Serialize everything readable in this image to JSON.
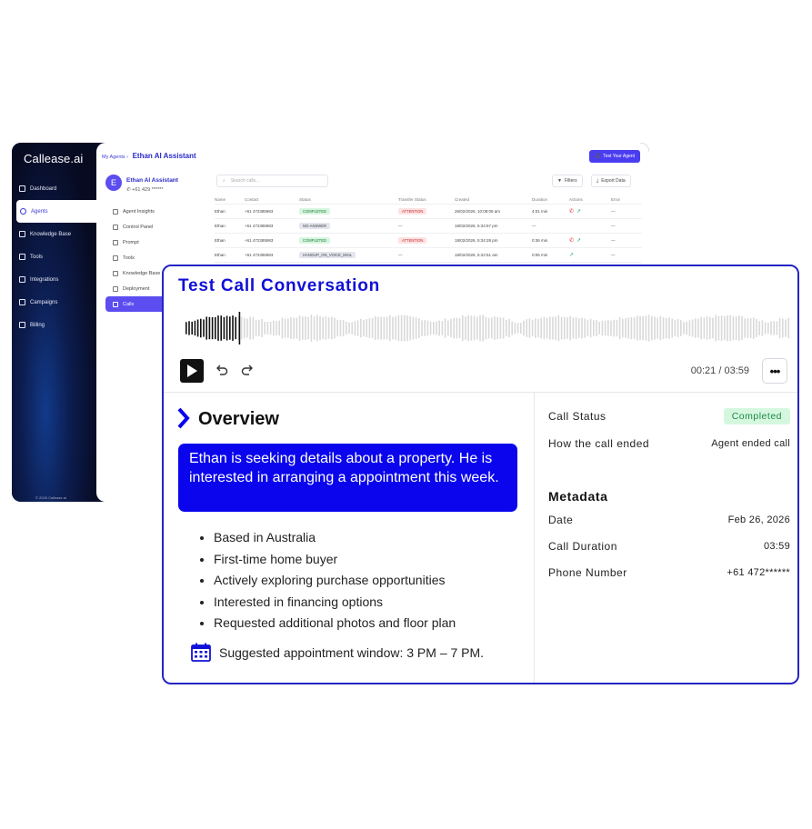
{
  "app": {
    "logo": "Callease.ai",
    "copyright": "© 2026 Callease.ai",
    "nav": [
      {
        "label": "Dashboard",
        "icon": "grid-icon"
      },
      {
        "label": "Agents",
        "icon": "agent-icon",
        "active": true
      },
      {
        "label": "Knowledge Base",
        "icon": "folder-icon"
      },
      {
        "label": "Tools",
        "icon": "bolt-icon"
      },
      {
        "label": "Integrations",
        "icon": "link-icon"
      },
      {
        "label": "Campaigns",
        "icon": "campaign-icon"
      },
      {
        "label": "Billing",
        "icon": "billing-icon"
      }
    ],
    "breadcrumb": {
      "root": "My Agents",
      "current": "Ethan AI Assistant"
    },
    "test_button": "Test Your Agent",
    "agent": {
      "initial": "E",
      "name": "Ethan AI Assistant",
      "phone": "+61 429 ******"
    },
    "sub_nav": [
      {
        "label": "Agent Insights"
      },
      {
        "label": "Control Panel"
      },
      {
        "label": "Prompt"
      },
      {
        "label": "Tools"
      },
      {
        "label": "Knowledge Base"
      },
      {
        "label": "Deployment"
      },
      {
        "label": "Calls",
        "active": true
      }
    ],
    "search_placeholder": "Search calls...",
    "filters_label": "Filters",
    "export_label": "Export Data",
    "table": {
      "headers": [
        "Name",
        "Contact",
        "Status",
        "Transfer Status",
        "Created",
        "Duration",
        "Actions",
        "Error"
      ],
      "rows": [
        {
          "name": "Ethan",
          "contact": "+61 472385983",
          "status": "COMPLETED",
          "status_kind": "green",
          "transfer": "ATTENTION",
          "created": "26/02/2026, 10:08:09 am",
          "duration": "4:01 min",
          "error": "—"
        },
        {
          "name": "Ethan",
          "contact": "+61 472385983",
          "status": "NO-ANSWER",
          "status_kind": "gray",
          "transfer": "—",
          "created": "18/02/2026, 5:34:57 pm",
          "duration": "—",
          "error": "—"
        },
        {
          "name": "Ethan",
          "contact": "+61 472385983",
          "status": "COMPLETED",
          "status_kind": "green",
          "transfer": "ATTENTION",
          "created": "18/02/2026, 5:34:28 pm",
          "duration": "0:36 min",
          "error": "—"
        },
        {
          "name": "Ethan",
          "contact": "+61 472385983",
          "status": "HANGUP_ON_VOICE_MAIL",
          "status_kind": "gray",
          "transfer": "—",
          "created": "18/02/2026, 5:22:51 am",
          "duration": "0:06 min",
          "error": "—"
        }
      ]
    }
  },
  "card": {
    "title": "Test Call Conversation",
    "playback": {
      "current": "00:21",
      "total": "03:59",
      "separator": " / ",
      "progress": 0.088
    },
    "overview_title": "Overview",
    "summary": "Ethan is seeking details about a property. He is interested in arranging a appointment this week.",
    "bullets": [
      "Based in Australia",
      "First-time home buyer",
      "Actively exploring purchase opportunities",
      "Interested in financing options",
      "Requested additional photos and floor plan"
    ],
    "appointment": "Suggested appointment window: 3 PM – 7 PM.",
    "call_status_label": "Call Status",
    "call_status_value": "Completed",
    "ended_label": "How the call ended",
    "ended_value": "Agent ended call",
    "metadata_title": "Metadata",
    "metadata": [
      {
        "label": "Date",
        "value": "Feb 26, 2026"
      },
      {
        "label": "Call Duration",
        "value": "03:59"
      },
      {
        "label": "Phone Number",
        "value": "+61 472******"
      }
    ],
    "colors": {
      "accent": "#0a05ec",
      "border": "#2525c4",
      "status_green": "#1a8b43"
    }
  }
}
